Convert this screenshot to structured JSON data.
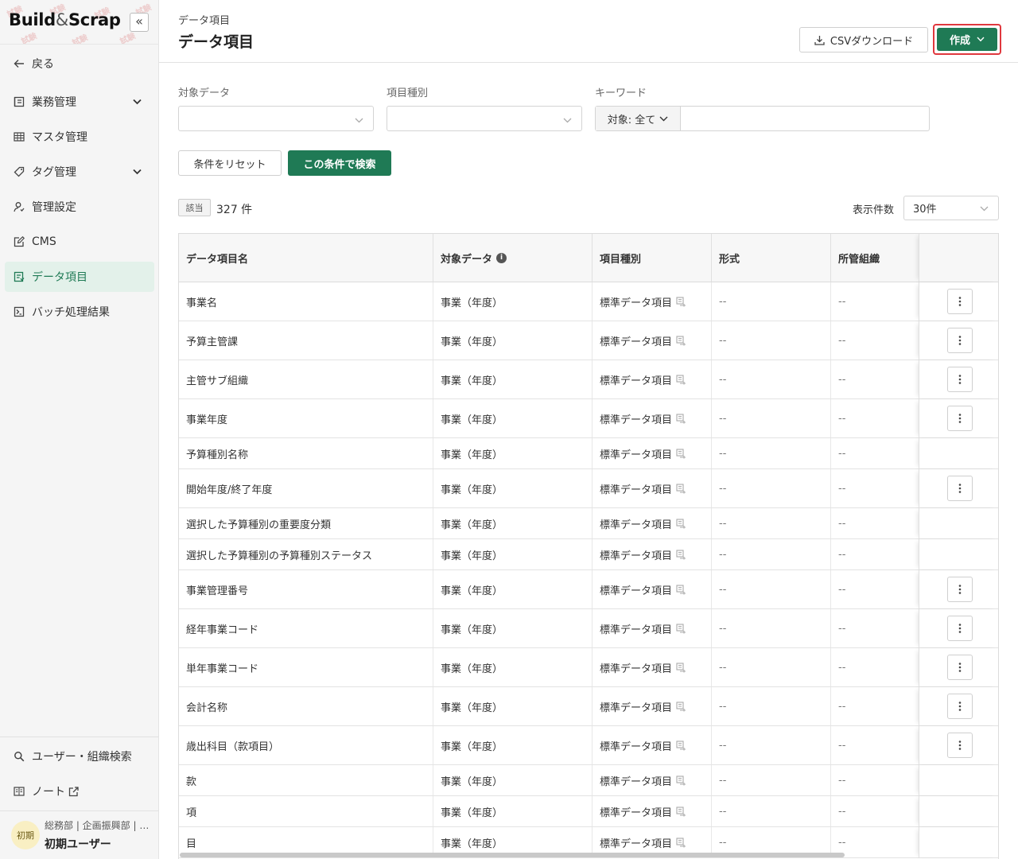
{
  "sidebar": {
    "logo": {
      "part1": "Build",
      "amp": "&",
      "part2": "Scrap",
      "stamp": "試験"
    },
    "collapse_label": "«",
    "back_label": "戻る",
    "items": [
      {
        "label": "業務管理",
        "icon": "book-icon",
        "has_chevron": true
      },
      {
        "label": "マスタ管理",
        "icon": "grid-icon",
        "has_chevron": false
      },
      {
        "label": "タグ管理",
        "icon": "tag-icon",
        "has_chevron": true
      },
      {
        "label": "管理設定",
        "icon": "user-gear-icon",
        "has_chevron": false
      },
      {
        "label": "CMS",
        "icon": "edit-icon",
        "has_chevron": false
      },
      {
        "label": "データ項目",
        "icon": "data-icon",
        "has_chevron": false,
        "active": true
      },
      {
        "label": "バッチ処理結果",
        "icon": "terminal-icon",
        "has_chevron": false
      }
    ],
    "bottom_items": [
      {
        "label": "ユーザー・組織検索",
        "icon": "search-icon"
      },
      {
        "label": "ノート",
        "icon": "notebook-icon",
        "external": true
      }
    ],
    "user": {
      "avatar": "初期",
      "org": "総務部 | 企画振興部 | …",
      "name": "初期ユーザー"
    }
  },
  "header": {
    "breadcrumb": "データ項目",
    "title": "データ項目",
    "csv_label": "CSVダウンロード",
    "create_label": "作成"
  },
  "filters": {
    "target_label": "対象データ",
    "type_label": "項目種別",
    "keyword_label": "キーワード",
    "scope_label": "対象: 全て",
    "keyword_value": "",
    "reset_label": "条件をリセット",
    "search_label": "この条件で検索"
  },
  "results": {
    "hit_label": "該当",
    "count_text": "327 件",
    "per_page_label": "表示件数",
    "per_page_value": "30件"
  },
  "table": {
    "columns": [
      "データ項目名",
      "対象データ",
      "項目種別",
      "形式",
      "所管組織"
    ],
    "rows": [
      {
        "name": "事業名",
        "target": "事業（年度）",
        "type": "標準データ項目",
        "format": "--",
        "org": "--",
        "menu": true
      },
      {
        "name": "予算主管課",
        "target": "事業（年度）",
        "type": "標準データ項目",
        "format": "--",
        "org": "--",
        "menu": true
      },
      {
        "name": "主管サブ組織",
        "target": "事業（年度）",
        "type": "標準データ項目",
        "format": "--",
        "org": "--",
        "menu": true
      },
      {
        "name": "事業年度",
        "target": "事業（年度）",
        "type": "標準データ項目",
        "format": "--",
        "org": "--",
        "menu": true
      },
      {
        "name": "予算種別名称",
        "target": "事業（年度）",
        "type": "標準データ項目",
        "format": "--",
        "org": "--",
        "menu": false
      },
      {
        "name": "開始年度/終了年度",
        "target": "事業（年度）",
        "type": "標準データ項目",
        "format": "--",
        "org": "--",
        "menu": true
      },
      {
        "name": "選択した予算種別の重要度分類",
        "target": "事業（年度）",
        "type": "標準データ項目",
        "format": "--",
        "org": "--",
        "menu": false
      },
      {
        "name": "選択した予算種別の予算種別ステータス",
        "target": "事業（年度）",
        "type": "標準データ項目",
        "format": "--",
        "org": "--",
        "menu": false
      },
      {
        "name": "事業管理番号",
        "target": "事業（年度）",
        "type": "標準データ項目",
        "format": "--",
        "org": "--",
        "menu": true
      },
      {
        "name": "経年事業コード",
        "target": "事業（年度）",
        "type": "標準データ項目",
        "format": "--",
        "org": "--",
        "menu": true
      },
      {
        "name": "単年事業コード",
        "target": "事業（年度）",
        "type": "標準データ項目",
        "format": "--",
        "org": "--",
        "menu": true
      },
      {
        "name": "会計名称",
        "target": "事業（年度）",
        "type": "標準データ項目",
        "format": "--",
        "org": "--",
        "menu": true
      },
      {
        "name": "歳出科目（款項目）",
        "target": "事業（年度）",
        "type": "標準データ項目",
        "format": "--",
        "org": "--",
        "menu": true
      },
      {
        "name": "款",
        "target": "事業（年度）",
        "type": "標準データ項目",
        "format": "--",
        "org": "--",
        "menu": false
      },
      {
        "name": "項",
        "target": "事業（年度）",
        "type": "標準データ項目",
        "format": "--",
        "org": "--",
        "menu": false
      },
      {
        "name": "目",
        "target": "事業（年度）",
        "type": "標準データ項目",
        "format": "--",
        "org": "--",
        "menu": false
      }
    ]
  },
  "colors": {
    "primary": "#1f7a55",
    "highlight": "#e0383e",
    "active_bg": "#e3f1ea"
  }
}
